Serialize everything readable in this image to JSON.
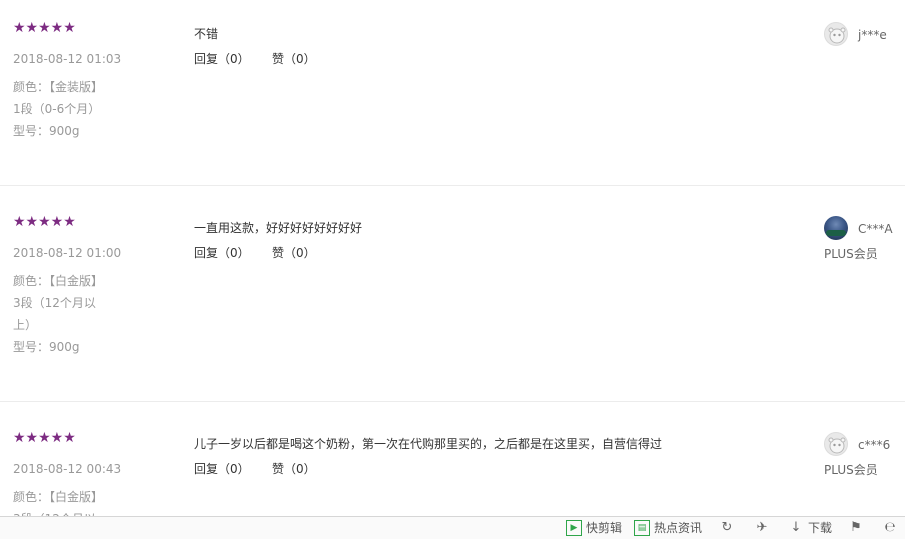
{
  "reviews": [
    {
      "stars": "★★★★★",
      "date": "2018-08-12 01:03",
      "attrs": [
        "颜色：【金装版】",
        "1段（0-6个月）",
        "型号：900g"
      ],
      "content": "不错",
      "reply_label": "回复（0）",
      "like_label": "赞（0）",
      "user": "j***e",
      "badge": ""
    },
    {
      "stars": "★★★★★",
      "date": "2018-08-12 01:00",
      "attrs": [
        "颜色：【白金版】",
        "3段（12个月以上）",
        "型号：900g"
      ],
      "content": "一直用这款，好好好好好好好好",
      "reply_label": "回复（0）",
      "like_label": "赞（0）",
      "user": "C***A",
      "badge": "PLUS会员"
    },
    {
      "stars": "★★★★★",
      "date": "2018-08-12 00:43",
      "attrs": [
        "颜色：【白金版】",
        "3段（12个月以"
      ],
      "content": "儿子一岁以后都是喝这个奶粉，第一次在代购那里买的，之后都是在这里买，自营信得过",
      "reply_label": "回复（0）",
      "like_label": "赞（0）",
      "user": "c***6",
      "badge": "PLUS会员"
    }
  ],
  "bottom_bar": {
    "quick_cut": "快剪辑",
    "hot_news": "热点资讯",
    "download": "下载"
  },
  "icons": {
    "quick_cut": "play-square-icon",
    "hot_news": "news-icon",
    "refresh": "refresh-icon",
    "pin": "pin-icon",
    "download": "download-arrow-icon",
    "flag": "flag-icon",
    "browser": "ie-icon"
  },
  "colors": {
    "stars": "#7d2c82",
    "accent_green": "#2fa54a"
  }
}
